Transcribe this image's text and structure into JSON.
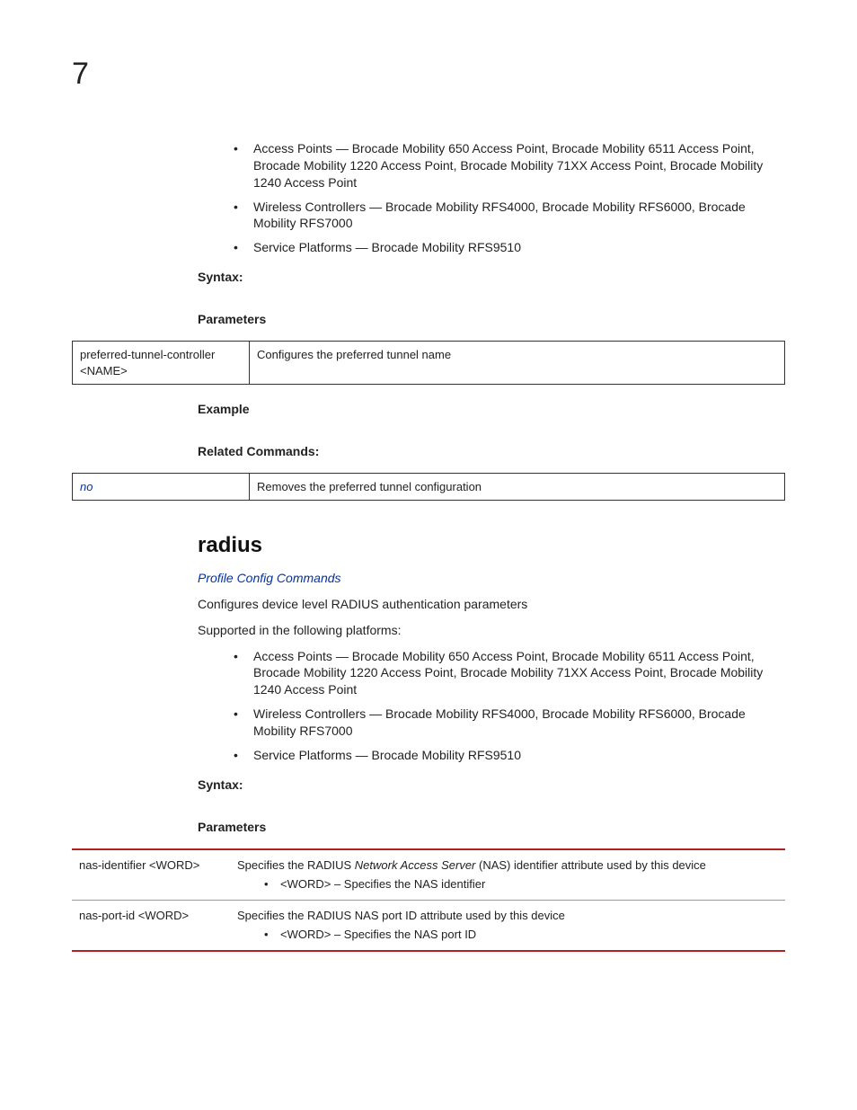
{
  "chapnum": "7",
  "s1": {
    "bullets": [
      "Access Points — Brocade Mobility 650 Access Point, Brocade Mobility 6511 Access Point, Brocade Mobility 1220 Access Point, Brocade Mobility 71XX Access Point, Brocade Mobility 1240 Access Point",
      "Wireless Controllers — Brocade Mobility RFS4000, Brocade Mobility RFS6000, Brocade Mobility RFS7000",
      "Service Platforms — Brocade Mobility RFS9510"
    ],
    "syntax_h": "Syntax:",
    "params_h": "Parameters",
    "ptable": {
      "c1": "preferred-tunnel-controller <NAME>",
      "c2": "Configures the preferred tunnel name"
    },
    "example_h": "Example",
    "related_h": "Related Commands:",
    "rtable": {
      "c1": "no",
      "c2": "Removes the preferred tunnel configuration"
    }
  },
  "s2": {
    "title": "radius",
    "link": "Profile Config Commands",
    "desc": "Configures device level RADIUS authentication parameters",
    "supported": "Supported in the following platforms:",
    "bullets": [
      "Access Points — Brocade Mobility 650 Access Point, Brocade Mobility 6511 Access Point, Brocade Mobility 1220 Access Point, Brocade Mobility 71XX Access Point, Brocade Mobility 1240 Access Point",
      "Wireless Controllers — Brocade Mobility RFS4000, Brocade Mobility RFS6000, Brocade Mobility RFS7000",
      "Service Platforms — Brocade Mobility RFS9510"
    ],
    "syntax_h": "Syntax:",
    "params_h": "Parameters",
    "ptable": [
      {
        "c1": "nas-identifier <WORD>",
        "c2_pre": "Specifies the RADIUS ",
        "c2_ital": "Network Access Server",
        "c2_post": " (NAS) identifier attribute used by this device",
        "sub": "<WORD> – Specifies the NAS identifier"
      },
      {
        "c1": "nas-port-id <WORD>",
        "c2_pre": "Specifies the RADIUS NAS port ID attribute used by this device",
        "c2_ital": "",
        "c2_post": "",
        "sub": "<WORD> – Specifies the NAS port ID"
      }
    ]
  }
}
